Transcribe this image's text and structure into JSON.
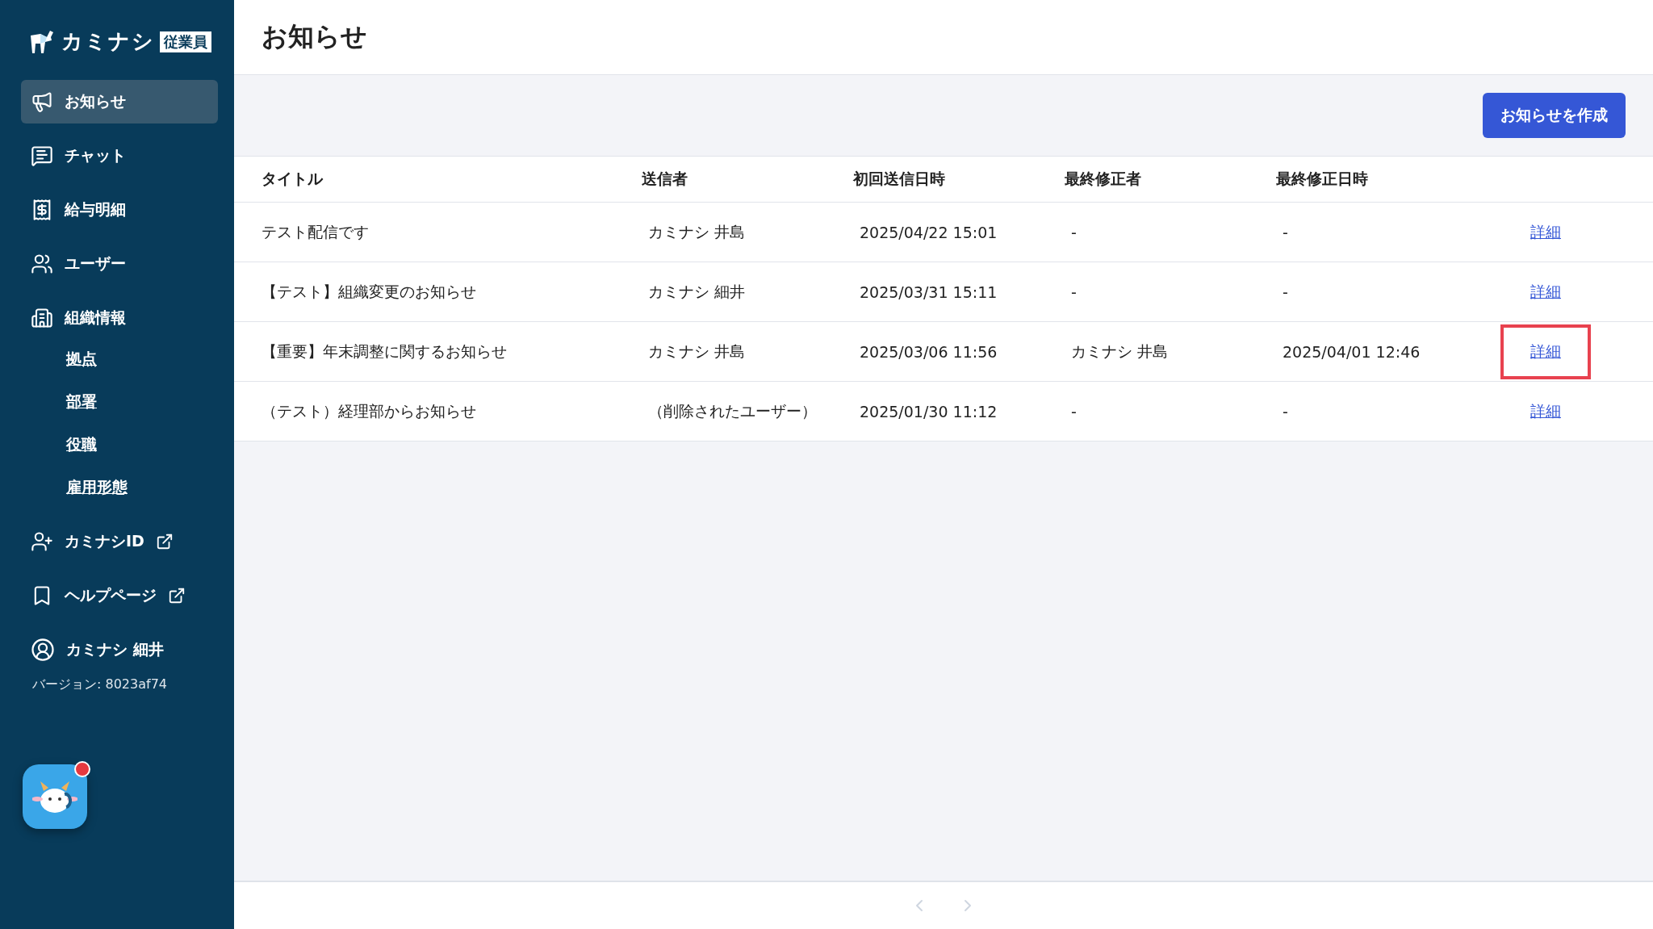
{
  "brand": {
    "name": "カミナシ",
    "badge": "従業員"
  },
  "sidebar": {
    "items": [
      {
        "label": "お知らせ",
        "selected": true,
        "external": false
      },
      {
        "label": "チャット",
        "selected": false,
        "external": false
      },
      {
        "label": "給与明細",
        "selected": false,
        "external": false
      },
      {
        "label": "ユーザー",
        "selected": false,
        "external": false
      },
      {
        "label": "組織情報",
        "selected": false,
        "external": false,
        "children": [
          {
            "label": "拠点"
          },
          {
            "label": "部署"
          },
          {
            "label": "役職"
          },
          {
            "label": "雇用形態"
          }
        ]
      },
      {
        "label": "カミナシID",
        "selected": false,
        "external": true
      },
      {
        "label": "ヘルプページ",
        "selected": false,
        "external": true
      }
    ],
    "user": "カミナシ 細井",
    "version": "バージョン: 8023af74",
    "support_notification": true
  },
  "page": {
    "title": "お知らせ"
  },
  "create_button": "お知らせを作成",
  "table": {
    "columns": [
      "タイトル",
      "送信者",
      "初回送信日時",
      "最終修正者",
      "最終修正日時"
    ],
    "rows": [
      {
        "cells": [
          "テスト配信です",
          "カミナシ 井島",
          "2025/04/22 15:01",
          "-",
          "-"
        ],
        "action": "詳細",
        "highlighted": false
      },
      {
        "cells": [
          "【テスト】組織変更のお知らせ",
          "カミナシ 細井",
          "2025/03/31 15:11",
          "-",
          "-"
        ],
        "action": "詳細",
        "highlighted": false
      },
      {
        "cells": [
          "【重要】年末調整に関するお知らせ",
          "カミナシ 井島",
          "2025/03/06 11:56",
          "カミナシ 井島",
          "2025/04/01 12:46"
        ],
        "action": "詳細",
        "highlighted": true
      },
      {
        "cells": [
          "（テスト）経理部からお知らせ",
          "（削除されたユーザー）",
          "2025/01/30 11:12",
          "-",
          "-"
        ],
        "action": "詳細",
        "highlighted": false
      }
    ]
  },
  "pagination": {
    "prev_disabled": true,
    "next_disabled": true
  }
}
